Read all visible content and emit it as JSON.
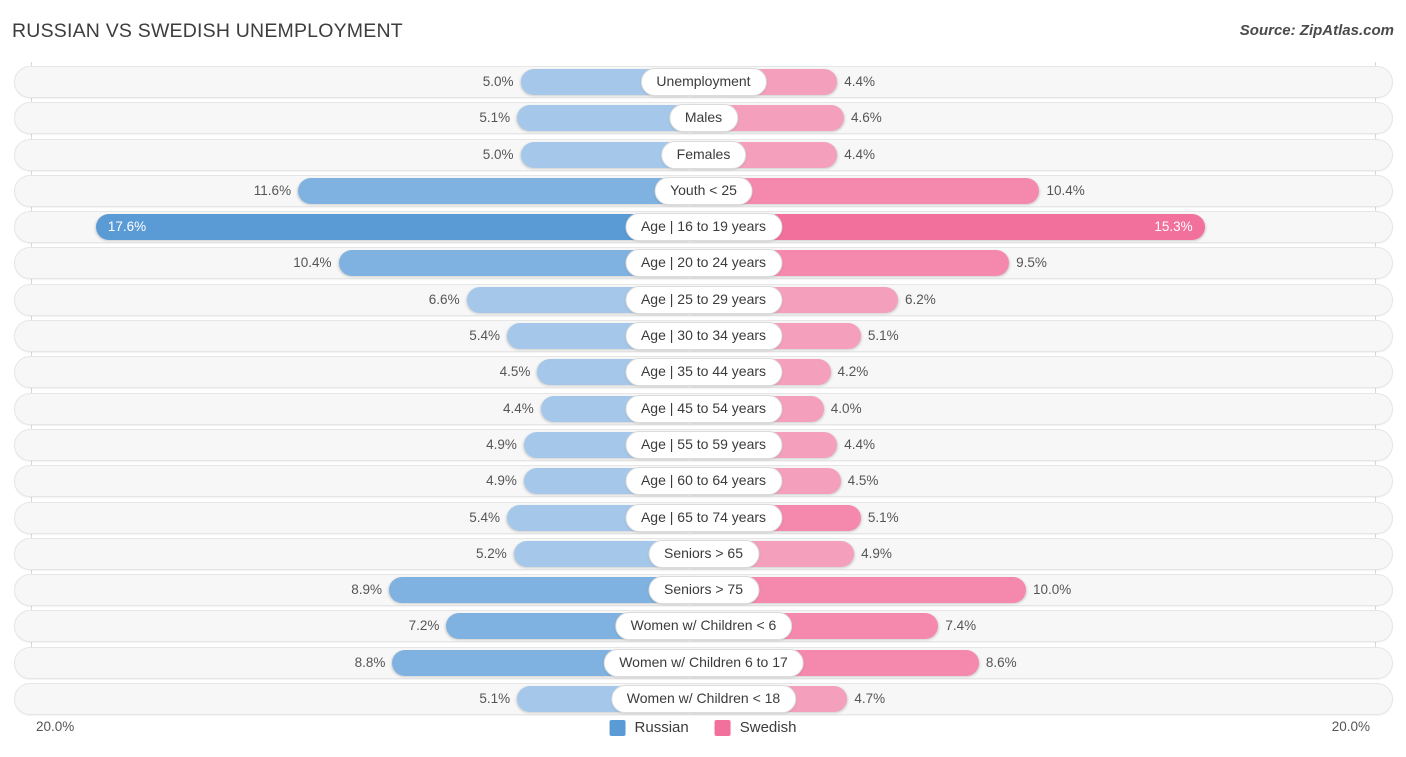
{
  "header": {
    "title": "RUSSIAN VS SWEDISH UNEMPLOYMENT",
    "source": "Source: ZipAtlas.com"
  },
  "footer": {
    "axis_left": "20.0%",
    "axis_right": "20.0%",
    "legend": [
      {
        "label": "Russian",
        "color": "#5b9bd5"
      },
      {
        "label": "Swedish",
        "color": "#f2709c"
      }
    ]
  },
  "colors": {
    "russian_light": "#a5c8ea",
    "russian_mid": "#7fb2e0",
    "russian_dark": "#5b9bd5",
    "swedish_light": "#f4a0bd",
    "swedish_mid": "#f589ad",
    "swedish_dark": "#f2709c",
    "row_track": "#f7f7f7",
    "gridline": "#d8d8d8"
  },
  "chart_data": {
    "type": "bar",
    "subtype": "diverging-bidirectional",
    "title": "RUSSIAN VS SWEDISH UNEMPLOYMENT",
    "xlabel": "",
    "ylabel": "",
    "xlim": [
      20.0,
      20.0
    ],
    "axis_max": 20.0,
    "units": "%",
    "grid": true,
    "legend_position": "bottom-center",
    "categories": [
      "Unemployment",
      "Males",
      "Females",
      "Youth < 25",
      "Age | 16 to 19 years",
      "Age | 20 to 24 years",
      "Age | 25 to 29 years",
      "Age | 30 to 34 years",
      "Age | 35 to 44 years",
      "Age | 45 to 54 years",
      "Age | 55 to 59 years",
      "Age | 60 to 64 years",
      "Age | 65 to 74 years",
      "Seniors > 65",
      "Seniors > 75",
      "Women w/ Children < 6",
      "Women w/ Children 6 to 17",
      "Women w/ Children < 18"
    ],
    "series": [
      {
        "name": "Russian",
        "color": "#5b9bd5",
        "side": "left",
        "values": [
          5.0,
          5.1,
          5.0,
          11.6,
          17.6,
          10.4,
          6.6,
          5.4,
          4.5,
          4.4,
          4.9,
          4.9,
          5.4,
          5.2,
          8.9,
          7.2,
          8.8,
          5.1
        ]
      },
      {
        "name": "Swedish",
        "color": "#f2709c",
        "side": "right",
        "values": [
          4.4,
          4.6,
          4.4,
          10.4,
          15.3,
          9.5,
          6.2,
          5.1,
          4.2,
          4.0,
          4.4,
          4.5,
          5.1,
          4.9,
          10.0,
          7.4,
          8.6,
          4.7
        ]
      }
    ]
  },
  "rows": [
    {
      "label": "Unemployment",
      "left_value": "5.0%",
      "right_value": "4.4%",
      "left_pct": 5.0,
      "right_pct": 4.4,
      "left_inside": false,
      "right_inside": false,
      "left_shade": "light",
      "right_shade": "light"
    },
    {
      "label": "Males",
      "left_value": "5.1%",
      "right_value": "4.6%",
      "left_pct": 5.1,
      "right_pct": 4.6,
      "left_inside": false,
      "right_inside": false,
      "left_shade": "light",
      "right_shade": "light"
    },
    {
      "label": "Females",
      "left_value": "5.0%",
      "right_value": "4.4%",
      "left_pct": 5.0,
      "right_pct": 4.4,
      "left_inside": false,
      "right_inside": false,
      "left_shade": "light",
      "right_shade": "light"
    },
    {
      "label": "Youth < 25",
      "left_value": "11.6%",
      "right_value": "10.4%",
      "left_pct": 11.6,
      "right_pct": 10.4,
      "left_inside": false,
      "right_inside": false,
      "left_shade": "mid",
      "right_shade": "mid"
    },
    {
      "label": "Age | 16 to 19 years",
      "left_value": "17.6%",
      "right_value": "15.3%",
      "left_pct": 17.6,
      "right_pct": 15.3,
      "left_inside": true,
      "right_inside": true,
      "left_shade": "dark",
      "right_shade": "dark"
    },
    {
      "label": "Age | 20 to 24 years",
      "left_value": "10.4%",
      "right_value": "9.5%",
      "left_pct": 10.4,
      "right_pct": 9.5,
      "left_inside": false,
      "right_inside": false,
      "left_shade": "mid",
      "right_shade": "mid"
    },
    {
      "label": "Age | 25 to 29 years",
      "left_value": "6.6%",
      "right_value": "6.2%",
      "left_pct": 6.6,
      "right_pct": 6.2,
      "left_inside": false,
      "right_inside": false,
      "left_shade": "light",
      "right_shade": "light"
    },
    {
      "label": "Age | 30 to 34 years",
      "left_value": "5.4%",
      "right_value": "5.1%",
      "left_pct": 5.4,
      "right_pct": 5.1,
      "left_inside": false,
      "right_inside": false,
      "left_shade": "light",
      "right_shade": "light"
    },
    {
      "label": "Age | 35 to 44 years",
      "left_value": "4.5%",
      "right_value": "4.2%",
      "left_pct": 4.5,
      "right_pct": 4.2,
      "left_inside": false,
      "right_inside": false,
      "left_shade": "light",
      "right_shade": "light"
    },
    {
      "label": "Age | 45 to 54 years",
      "left_value": "4.4%",
      "right_value": "4.0%",
      "left_pct": 4.4,
      "right_pct": 4.0,
      "left_inside": false,
      "right_inside": false,
      "left_shade": "light",
      "right_shade": "light"
    },
    {
      "label": "Age | 55 to 59 years",
      "left_value": "4.9%",
      "right_value": "4.4%",
      "left_pct": 4.9,
      "right_pct": 4.4,
      "left_inside": false,
      "right_inside": false,
      "left_shade": "light",
      "right_shade": "light"
    },
    {
      "label": "Age | 60 to 64 years",
      "left_value": "4.9%",
      "right_value": "4.5%",
      "left_pct": 4.9,
      "right_pct": 4.5,
      "left_inside": false,
      "right_inside": false,
      "left_shade": "light",
      "right_shade": "light"
    },
    {
      "label": "Age | 65 to 74 years",
      "left_value": "5.4%",
      "right_value": "5.1%",
      "left_pct": 5.4,
      "right_pct": 5.1,
      "left_inside": false,
      "right_inside": false,
      "left_shade": "light",
      "right_shade": "mid"
    },
    {
      "label": "Seniors > 65",
      "left_value": "5.2%",
      "right_value": "4.9%",
      "left_pct": 5.2,
      "right_pct": 4.9,
      "left_inside": false,
      "right_inside": false,
      "left_shade": "light",
      "right_shade": "light"
    },
    {
      "label": "Seniors > 75",
      "left_value": "8.9%",
      "right_value": "10.0%",
      "left_pct": 8.9,
      "right_pct": 10.0,
      "left_inside": false,
      "right_inside": false,
      "left_shade": "mid",
      "right_shade": "mid"
    },
    {
      "label": "Women w/ Children < 6",
      "left_value": "7.2%",
      "right_value": "7.4%",
      "left_pct": 7.2,
      "right_pct": 7.4,
      "left_inside": false,
      "right_inside": false,
      "left_shade": "mid",
      "right_shade": "mid"
    },
    {
      "label": "Women w/ Children 6 to 17",
      "left_value": "8.8%",
      "right_value": "8.6%",
      "left_pct": 8.8,
      "right_pct": 8.6,
      "left_inside": false,
      "right_inside": false,
      "left_shade": "mid",
      "right_shade": "mid"
    },
    {
      "label": "Women w/ Children < 18",
      "left_value": "5.1%",
      "right_value": "4.7%",
      "left_pct": 5.1,
      "right_pct": 4.7,
      "left_inside": false,
      "right_inside": false,
      "left_shade": "light",
      "right_shade": "light"
    }
  ]
}
